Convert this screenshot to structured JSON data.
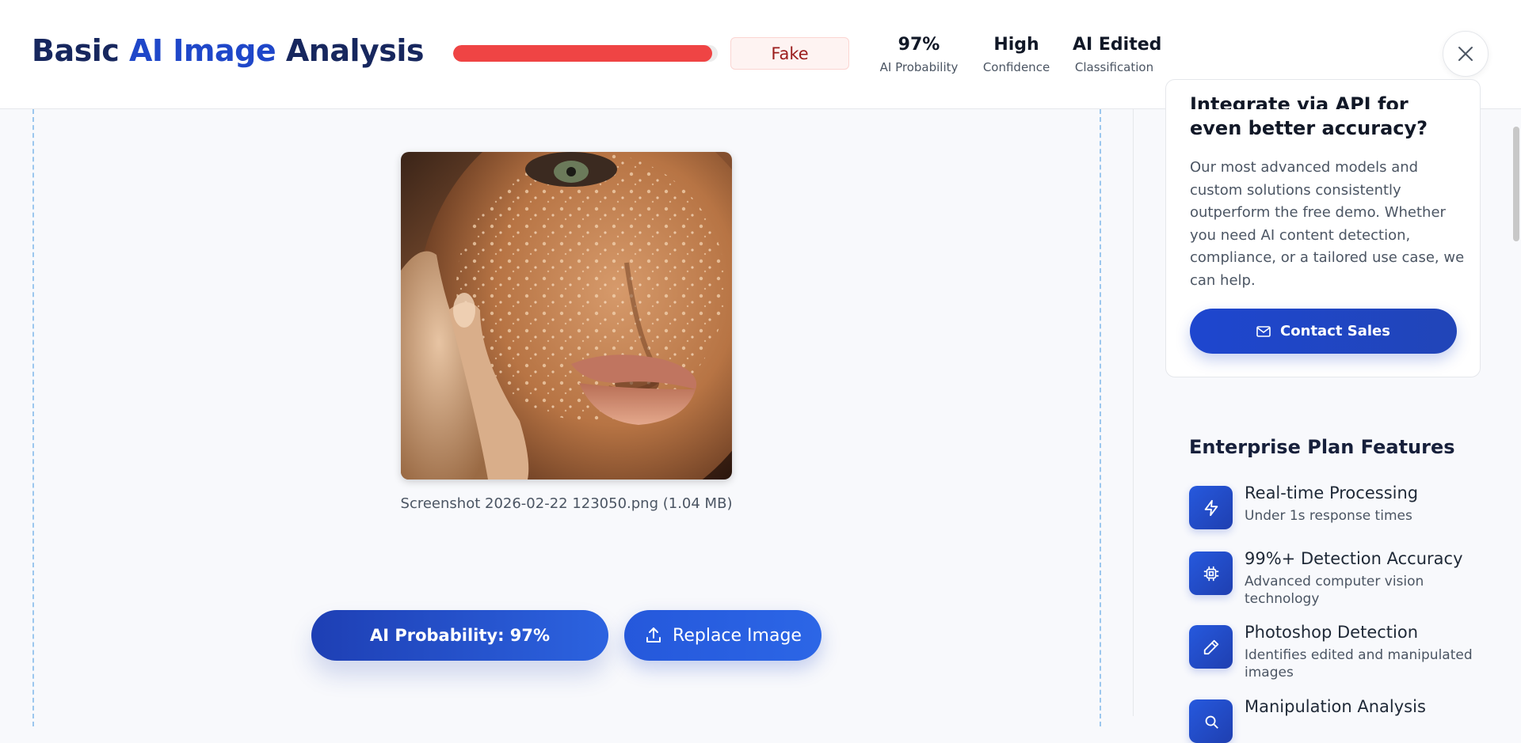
{
  "header": {
    "title_prefix": "Basic",
    "title_accent": "AI Image",
    "title_suffix": "Analysis",
    "verdict": "Fake",
    "progress_fraction": 0.98,
    "stats": [
      {
        "value": "97%",
        "label": "AI Probability"
      },
      {
        "value": "High",
        "label": "Confidence"
      },
      {
        "value": "AI Edited",
        "label": "Classification"
      }
    ]
  },
  "main": {
    "file_caption": "Screenshot 2026-02-22 123050.png (1.04 MB)",
    "ai_probability_button": "AI Probability: 97%",
    "replace_button": "Replace Image"
  },
  "sidebar": {
    "promo": {
      "heading_line1": "Integrate via API for",
      "heading_line2": "even better accuracy?",
      "body": "Our most advanced models and custom solutions consistently outperform the free demo. Whether you need AI content detection, compliance, or a tailored use case, we can help.",
      "cta": "Contact Sales"
    },
    "features_heading": "Enterprise Plan Features",
    "features": [
      {
        "title": "Real-time Processing",
        "desc": "Under 1s response times",
        "icon": "lightning-icon"
      },
      {
        "title": "99%+ Detection Accuracy",
        "desc": "Advanced computer vision technology",
        "icon": "chip-icon"
      },
      {
        "title": "Photoshop Detection",
        "desc": "Identifies edited and manipulated images",
        "icon": "pencil-icon"
      },
      {
        "title": "Manipulation Analysis",
        "desc": "",
        "icon": "search-icon"
      }
    ]
  },
  "colors": {
    "brand_dark": "#17275e",
    "brand_accent": "#1f47c9",
    "fake_red": "#ef4444",
    "button_blue": "#2558db"
  }
}
